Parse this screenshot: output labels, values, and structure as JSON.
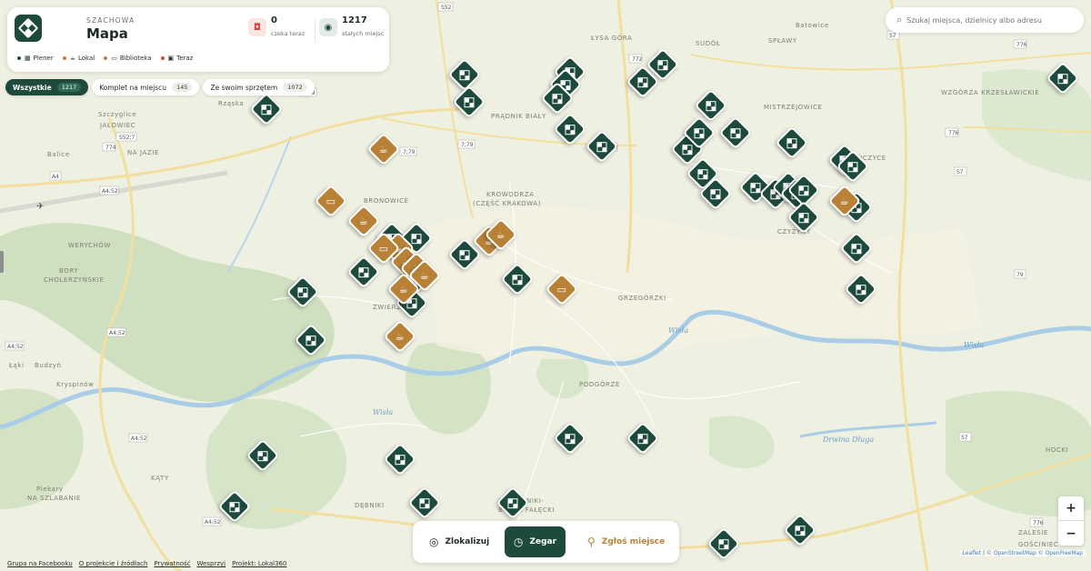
{
  "app": {
    "eyebrow": "SZACHOWA",
    "title": "Mapa",
    "stats": {
      "waiting": {
        "value": "0",
        "label": "czeka teraz",
        "icon": "table-clock-icon"
      },
      "places": {
        "value": "1217",
        "label": "stałych miejsc",
        "icon": "pin-icon"
      }
    },
    "legend": [
      {
        "label": "Plener",
        "color": "#1d4a3c",
        "icon": "board-icon"
      },
      {
        "label": "Lokal",
        "color": "#b98136",
        "icon": "cup-icon"
      },
      {
        "label": "Biblioteka",
        "color": "#b98136",
        "icon": "book-icon"
      },
      {
        "label": "Teraz",
        "color": "#d9453d",
        "icon": "table-icon"
      }
    ]
  },
  "filters": [
    {
      "label": "Wszystkie",
      "count": "1217",
      "active": true
    },
    {
      "label": "Komplet na miejscu",
      "count": "145",
      "active": false
    },
    {
      "label": "Ze swoim sprzętem",
      "count": "1072",
      "active": false
    }
  ],
  "search": {
    "placeholder": "Szukaj miejsca, dzielnicy albo adresu",
    "icon": "search-icon"
  },
  "bottombar": {
    "locate": "Zlokalizuj",
    "clock": "Zegar",
    "report": "Zgłoś miejsce"
  },
  "zoom": {
    "in": "+",
    "out": "−"
  },
  "attribution": {
    "leaflet": "Leaflet",
    "text1": "© OpenStreetMap",
    "text2": "© OpenFreeMap"
  },
  "footer": [
    "Grupa na Facebooku",
    "O projekcie i źródłach",
    "Prywatność",
    "Wesprzyj",
    "Projekt: Lokal360"
  ],
  "map_labels": {
    "places": [
      "Batowice",
      "ŁYSA GÓRA",
      "SUDÓŁ",
      "SPŁAWY",
      "WZGÓRZA KRZESŁAWICKIE",
      "Szczyglice",
      "JAŁOWIEC",
      "Rząska",
      "PRĄDNIK BIAŁY",
      "MISTRZEJOWICE",
      "Balice",
      "NA JAZIE",
      "BIEŃCZYCE",
      "BRONOWICE",
      "KROWODRZA (CZĘŚĆ KRAKOWA)",
      "WERYCHÓW",
      "CZYŻYNY",
      "BORY CHOLERZYŃSKIE",
      "ZWIERZYNIEC",
      "GRZEGÓRZKI",
      "Łąki",
      "Budzyń",
      "Kryspinów",
      "PODGÓRZE",
      "Wisła",
      "Wisła",
      "Wisła",
      "Drwina Długa",
      "HOCKI",
      "KĄTY",
      "Piekary",
      "NA SZLABANIE",
      "ŁAGIEWNIKI-BOREK FAŁĘCKI",
      "DĘBNIKI",
      "ZALESIE",
      "GOŚCINIEC"
    ],
    "roads": [
      "S52",
      "S52",
      "772",
      "7;79",
      "7;79",
      "7;79",
      "772",
      "S52;7",
      "774",
      "A4",
      "A4;52",
      "A4;52",
      "A4;52",
      "A4;52",
      "776",
      "776",
      "S7",
      "S7",
      "79",
      "S7",
      "776"
    ]
  },
  "markers": [
    {
      "type": "plener",
      "lat": 50.098,
      "lon": 19.95
    },
    {
      "type": "plener",
      "lat": 50.094,
      "lon": 19.951
    },
    {
      "type": "plener",
      "lat": 50.093,
      "lon": 19.901
    },
    {
      "type": "plener",
      "lat": 50.0985,
      "lon": 19.976
    },
    {
      "type": "plener",
      "lat": 50.0965,
      "lon": 19.975
    },
    {
      "type": "plener",
      "lat": 50.0945,
      "lon": 19.973
    },
    {
      "type": "plener",
      "lat": 50.09,
      "lon": 19.976
    },
    {
      "type": "plener",
      "lat": 50.0875,
      "lon": 19.984
    },
    {
      "type": "plener",
      "lat": 50.0995,
      "lon": 19.999
    },
    {
      "type": "plener",
      "lat": 50.097,
      "lon": 19.994
    },
    {
      "type": "plener",
      "lat": 50.087,
      "lon": 20.005
    },
    {
      "type": "plener",
      "lat": 50.0895,
      "lon": 20.008
    },
    {
      "type": "plener",
      "lat": 50.0935,
      "lon": 20.011
    },
    {
      "type": "plener",
      "lat": 50.0835,
      "lon": 20.009
    },
    {
      "type": "plener",
      "lat": 50.0805,
      "lon": 20.012
    },
    {
      "type": "plener",
      "lat": 50.0895,
      "lon": 20.017
    },
    {
      "type": "plener",
      "lat": 50.0815,
      "lon": 20.022
    },
    {
      "type": "plener",
      "lat": 50.0805,
      "lon": 20.027
    },
    {
      "type": "plener",
      "lat": 50.088,
      "lon": 20.031
    },
    {
      "type": "plener",
      "lat": 50.0815,
      "lon": 20.03
    },
    {
      "type": "plener",
      "lat": 50.0805,
      "lon": 20.032
    },
    {
      "type": "plener",
      "lat": 50.081,
      "lon": 20.034
    },
    {
      "type": "plener",
      "lat": 50.077,
      "lon": 20.034
    },
    {
      "type": "plener",
      "lat": 50.0855,
      "lon": 20.044
    },
    {
      "type": "plener",
      "lat": 50.0845,
      "lon": 20.046
    },
    {
      "type": "plener",
      "lat": 50.0785,
      "lon": 20.047
    },
    {
      "type": "plener",
      "lat": 50.0725,
      "lon": 20.047
    },
    {
      "type": "plener",
      "lat": 50.0665,
      "lon": 20.048
    },
    {
      "type": "plener",
      "lat": 50.0975,
      "lon": 20.098
    },
    {
      "type": "plener",
      "lat": 50.074,
      "lon": 19.932
    },
    {
      "type": "plener",
      "lat": 50.074,
      "lon": 19.938
    },
    {
      "type": "plener",
      "lat": 50.069,
      "lon": 19.925
    },
    {
      "type": "plener",
      "lat": 50.066,
      "lon": 19.91
    },
    {
      "type": "plener",
      "lat": 50.0675,
      "lon": 19.937
    },
    {
      "type": "plener",
      "lat": 50.0645,
      "lon": 19.937
    },
    {
      "type": "plener",
      "lat": 50.0715,
      "lon": 19.95
    },
    {
      "type": "plener",
      "lat": 50.068,
      "lon": 19.963
    },
    {
      "type": "plener",
      "lat": 50.059,
      "lon": 19.912
    },
    {
      "type": "plener",
      "lat": 50.0445,
      "lon": 19.976
    },
    {
      "type": "plener",
      "lat": 50.0445,
      "lon": 19.994
    },
    {
      "type": "plener",
      "lat": 50.042,
      "lon": 19.9
    },
    {
      "type": "plener",
      "lat": 50.0415,
      "lon": 19.934
    },
    {
      "type": "plener",
      "lat": 50.035,
      "lon": 19.94
    },
    {
      "type": "plener",
      "lat": 50.035,
      "lon": 19.962
    },
    {
      "type": "plener",
      "lat": 50.0345,
      "lon": 19.893
    },
    {
      "type": "plener",
      "lat": 50.029,
      "lon": 20.014
    },
    {
      "type": "plener",
      "lat": 50.031,
      "lon": 20.033
    },
    {
      "type": "lokal",
      "lat": 50.087,
      "lon": 19.93
    },
    {
      "type": "lokal",
      "lat": 50.0765,
      "lon": 19.925
    },
    {
      "type": "lokal",
      "lat": 50.0725,
      "lon": 19.9335
    },
    {
      "type": "lokal",
      "lat": 50.0705,
      "lon": 19.9355
    },
    {
      "type": "lokal",
      "lat": 50.0695,
      "lon": 19.938
    },
    {
      "type": "lokal",
      "lat": 50.0685,
      "lon": 19.94
    },
    {
      "type": "lokal",
      "lat": 50.0665,
      "lon": 19.935
    },
    {
      "type": "lokal",
      "lat": 50.0735,
      "lon": 19.956
    },
    {
      "type": "lokal",
      "lat": 50.0745,
      "lon": 19.959
    },
    {
      "type": "lokal",
      "lat": 50.0595,
      "lon": 19.934
    },
    {
      "type": "lokal",
      "lat": 50.0795,
      "lon": 20.044
    },
    {
      "type": "biblioteka",
      "lat": 50.0795,
      "lon": 19.917
    },
    {
      "type": "biblioteka",
      "lat": 50.0725,
      "lon": 19.93
    },
    {
      "type": "biblioteka",
      "lat": 50.0665,
      "lon": 19.974
    }
  ]
}
